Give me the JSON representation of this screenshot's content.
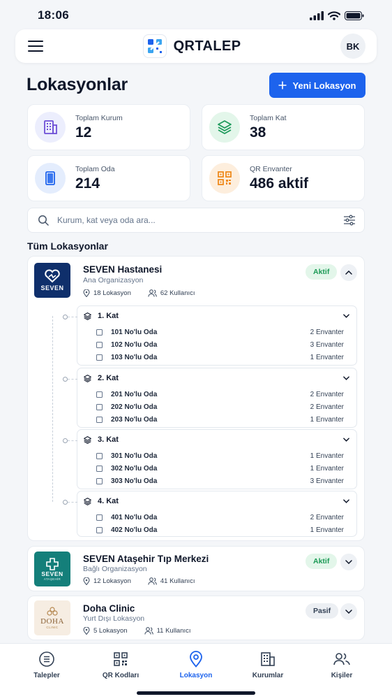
{
  "status_bar": {
    "time": "18:06"
  },
  "header": {
    "brand": "QRTALEP",
    "avatar_initials": "BK"
  },
  "page": {
    "title": "Lokasyonlar",
    "new_button": "Yeni Lokasyon"
  },
  "stats": [
    {
      "label": "Toplam Kurum",
      "value": "12",
      "icon": "building-icon",
      "color": "#6d4fd6"
    },
    {
      "label": "Toplam Kat",
      "value": "38",
      "icon": "layers-icon",
      "color": "#1f9a5c"
    },
    {
      "label": "Toplam Oda",
      "value": "214",
      "icon": "door-icon",
      "color": "#1d63ed"
    },
    {
      "label": "QR Envanter",
      "value": "486 aktif",
      "icon": "qr-icon",
      "color": "#ef8a1c"
    }
  ],
  "search": {
    "placeholder": "Kurum, kat veya oda ara..."
  },
  "section": {
    "title": "Tüm Lokasyonlar"
  },
  "organizations": [
    {
      "name": "SEVEN Hastanesi",
      "subtitle": "Ana Organizasyon",
      "locations": "18 Lokasyon",
      "users": "62 Kullanıcı",
      "status": "Aktif",
      "logo_text": "SEVEN",
      "expanded": true,
      "floors": [
        {
          "name": "1. Kat",
          "rooms": [
            {
              "name": "101 No'lu Oda",
              "inventory": "2 Envanter"
            },
            {
              "name": "102 No'lu Oda",
              "inventory": "3 Envanter"
            },
            {
              "name": "103 No'lu Oda",
              "inventory": "1 Envanter"
            }
          ]
        },
        {
          "name": "2. Kat",
          "rooms": [
            {
              "name": "201 No'lu Oda",
              "inventory": "2 Envanter"
            },
            {
              "name": "202 No'lu Oda",
              "inventory": "2 Envanter"
            },
            {
              "name": "203 No'lu Oda",
              "inventory": "1 Envanter"
            }
          ]
        },
        {
          "name": "3. Kat",
          "rooms": [
            {
              "name": "301 No'lu Oda",
              "inventory": "1 Envanter"
            },
            {
              "name": "302 No'lu Oda",
              "inventory": "1 Envanter"
            },
            {
              "name": "303 No'lu Oda",
              "inventory": "3 Envanter"
            }
          ]
        },
        {
          "name": "4. Kat",
          "rooms": [
            {
              "name": "401 No'lu Oda",
              "inventory": "2 Envanter"
            },
            {
              "name": "402 No'lu Oda",
              "inventory": "1 Envanter"
            }
          ]
        }
      ]
    },
    {
      "name": "SEVEN Ataşehir Tıp Merkezi",
      "subtitle": "Bağlı Organizasyon",
      "locations": "12 Lokasyon",
      "users": "41 Kullanıcı",
      "status": "Aktif",
      "logo_text": "SEVEN",
      "logo_subtext": "ATAŞEHİR",
      "expanded": false
    },
    {
      "name": "Doha Clinic",
      "subtitle": "Yurt Dışı Lokasyon",
      "locations": "5 Lokasyon",
      "users": "11 Kullanıcı",
      "status": "Pasif",
      "logo_text": "DOHA",
      "logo_subtext": "CLINIC",
      "expanded": false
    }
  ],
  "bottom_nav": [
    {
      "label": "Talepler",
      "icon": "list-icon",
      "active": false
    },
    {
      "label": "QR Kodları",
      "icon": "qr-icon",
      "active": false
    },
    {
      "label": "Lokasyon",
      "icon": "location-pin-icon",
      "active": true
    },
    {
      "label": "Kurumlar",
      "icon": "building-icon",
      "active": false
    },
    {
      "label": "Kişiler",
      "icon": "users-icon",
      "active": false
    }
  ],
  "colors": {
    "primary": "#1d63ed",
    "active_badge": "#1b9a55",
    "seven_navy": "#0f2f6b",
    "seven_teal": "#147f7a",
    "doha_gold": "#b5874f"
  }
}
